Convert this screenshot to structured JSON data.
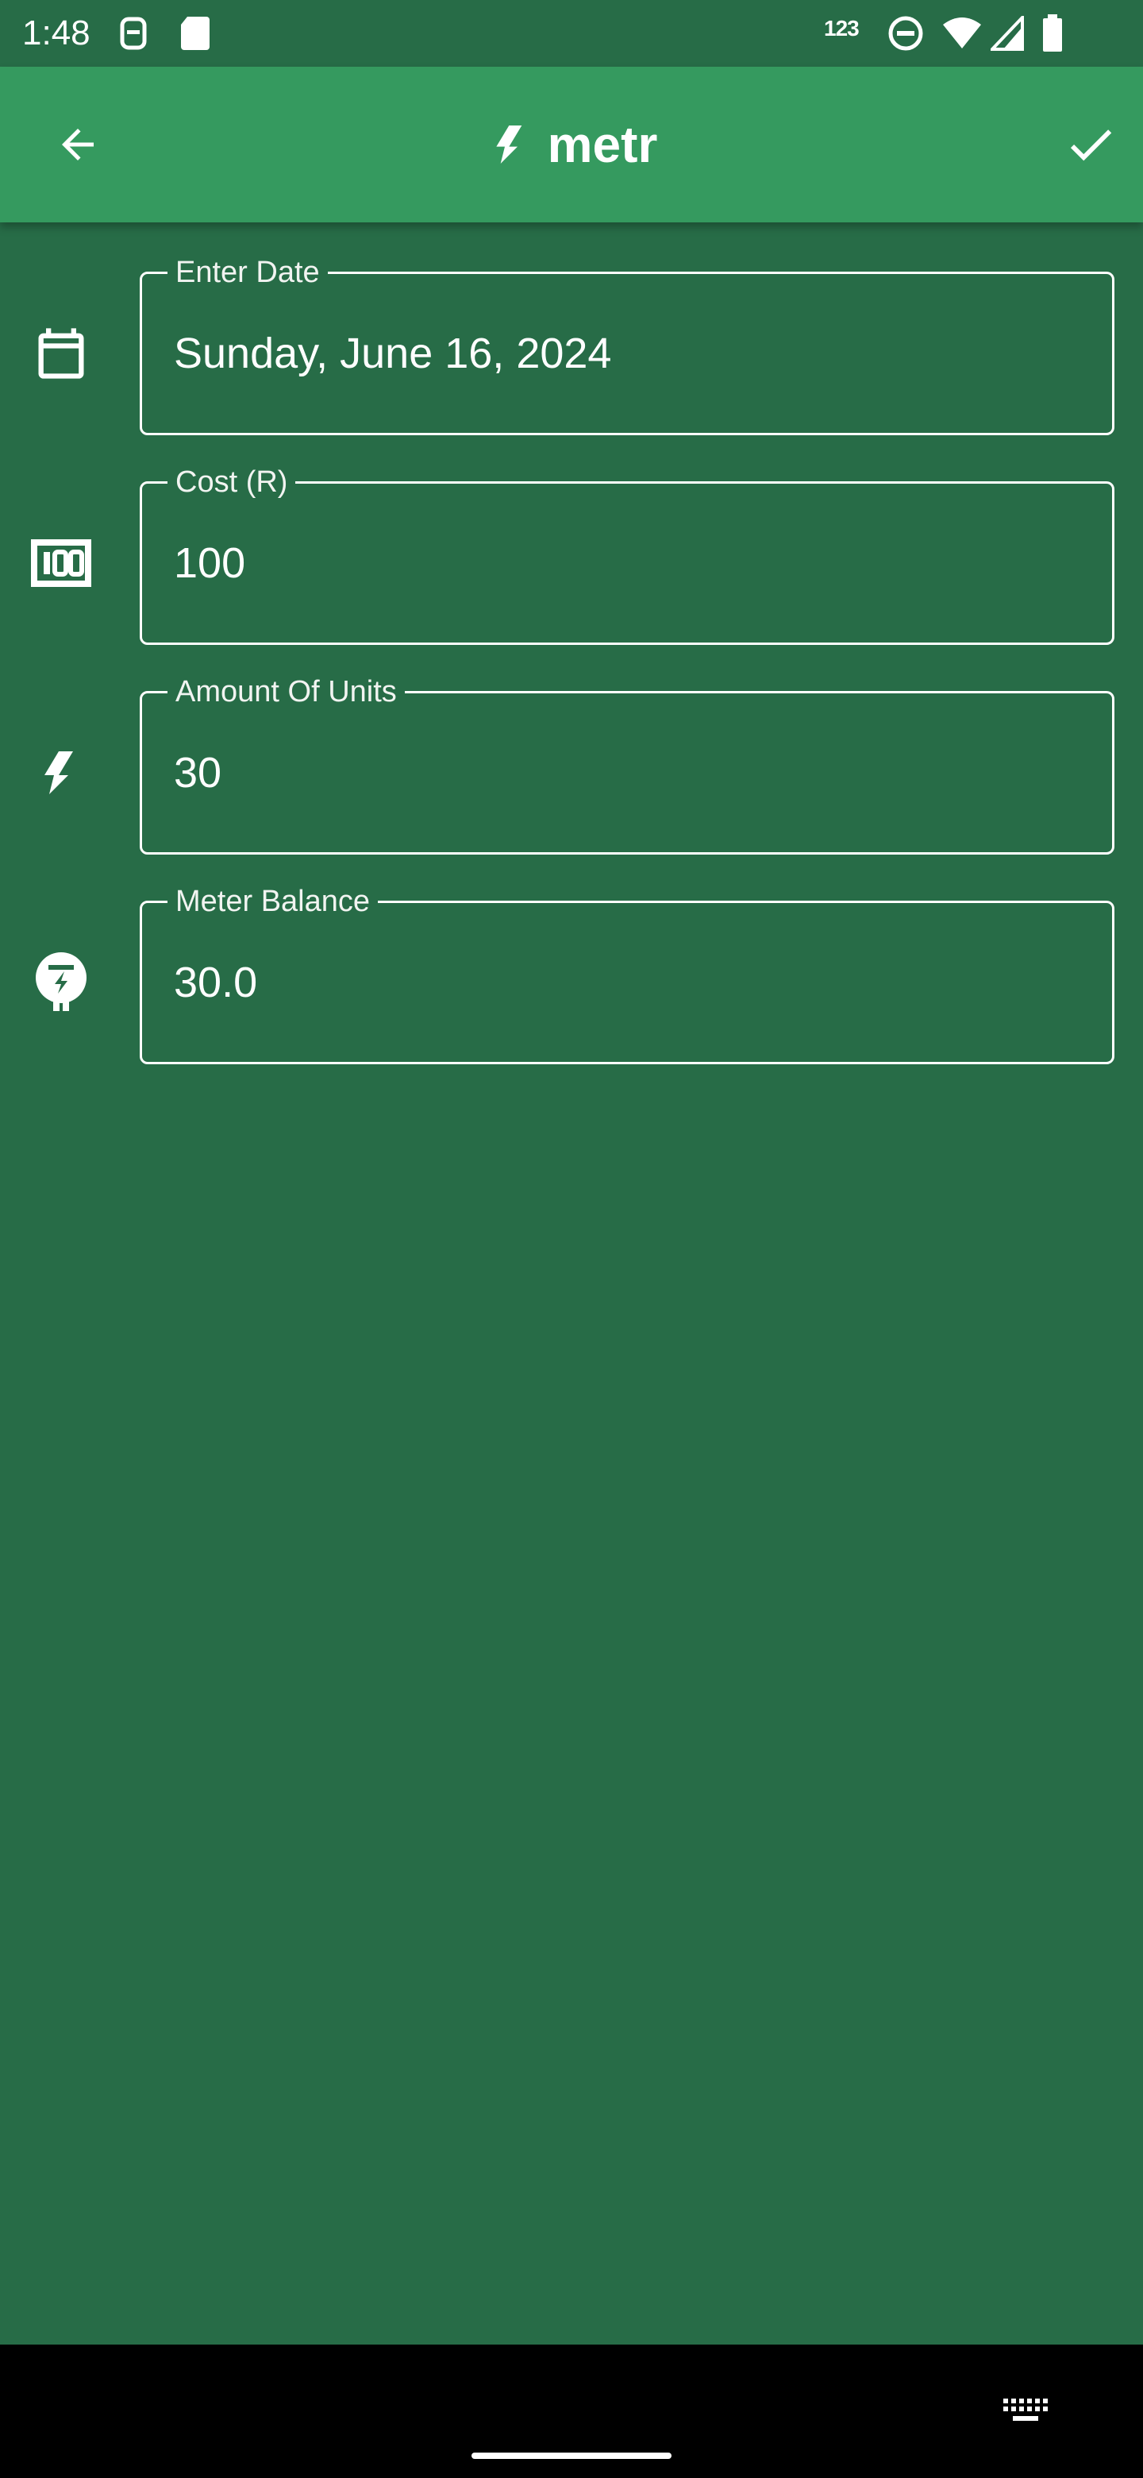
{
  "status_bar": {
    "time": "1:48",
    "network_label": "123",
    "icons": [
      "face-unlock-icon",
      "sd-card-icon",
      "do-not-disturb-icon",
      "wifi-icon",
      "signal-icon",
      "battery-icon"
    ]
  },
  "app_bar": {
    "title": "metr",
    "back_icon": "arrow-back-icon",
    "confirm_icon": "check-icon",
    "title_icon": "bolt-icon"
  },
  "form": {
    "fields": [
      {
        "label": "Enter Date",
        "value": "Sunday, June 16, 2024",
        "icon": "calendar-icon"
      },
      {
        "label": "Cost (R)",
        "value": "100",
        "icon": "money-icon"
      },
      {
        "label": "Amount Of Units",
        "value": "30",
        "icon": "bolt-icon"
      },
      {
        "label": "Meter Balance",
        "value": "30.0",
        "icon": "meter-icon"
      }
    ]
  },
  "nav_bar": {
    "keyboard_icon": "keyboard-icon"
  },
  "colors": {
    "background": "#276c47",
    "app_bar": "#359a5f",
    "text": "#ffffff"
  }
}
